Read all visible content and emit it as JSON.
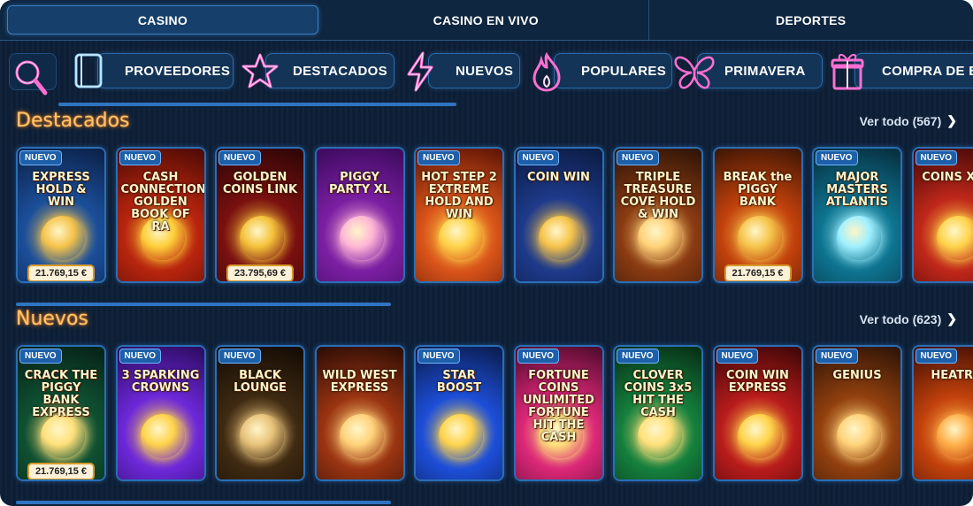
{
  "tabs": [
    "CASINO",
    "CASINO EN VIVO",
    "DEPORTES"
  ],
  "categories": [
    {
      "label": "PROVEEDORES",
      "icon": "book-icon"
    },
    {
      "label": "DESTACADOS",
      "icon": "star-icon"
    },
    {
      "label": "NUEVOS",
      "icon": "lightning-icon"
    },
    {
      "label": "POPULARES",
      "icon": "fire-icon"
    },
    {
      "label": "PRIMAVERA",
      "icon": "butterfly-icon"
    },
    {
      "label": "COMPRA DE BO",
      "icon": "gift-icon"
    }
  ],
  "sections": [
    {
      "title": "Destacados",
      "see_all": "Ver todo (567)",
      "games": [
        {
          "badge": "NUEVO",
          "title": "EXPRESS HOLD & WIN",
          "jackpot": "21.769,15 €"
        },
        {
          "badge": "NUEVO",
          "title": "CASH CONNECTION GOLDEN BOOK OF RA",
          "jackpot": ""
        },
        {
          "badge": "NUEVO",
          "title": "GOLDEN COINS LINK",
          "jackpot": "23.795,69 €"
        },
        {
          "badge": "",
          "title": "PIGGY PARTY XL",
          "jackpot": ""
        },
        {
          "badge": "NUEVO",
          "title": "HOT STEP 2 EXTREME HOLD AND WIN",
          "jackpot": ""
        },
        {
          "badge": "NUEVO",
          "title": "COIN WIN",
          "jackpot": ""
        },
        {
          "badge": "NUEVO",
          "title": "TRIPLE TREASURE COVE HOLD & WIN",
          "jackpot": ""
        },
        {
          "badge": "",
          "title": "BREAK the PIGGY BANK",
          "jackpot": "21.769,15 €"
        },
        {
          "badge": "NUEVO",
          "title": "MAJOR MASTERS ATLANTIS",
          "jackpot": ""
        },
        {
          "badge": "NUEVO",
          "title": "COINS XXL",
          "jackpot": ""
        }
      ]
    },
    {
      "title": "Nuevos",
      "see_all": "Ver todo (623)",
      "games": [
        {
          "badge": "NUEVO",
          "title": "CRACK THE PIGGY BANK EXPRESS",
          "jackpot": "21.769,15 €"
        },
        {
          "badge": "NUEVO",
          "title": "3 SPARKING CROWNS",
          "jackpot": ""
        },
        {
          "badge": "NUEVO",
          "title": "BLACK LOUNGE",
          "jackpot": ""
        },
        {
          "badge": "",
          "title": "WILD WEST EXPRESS",
          "jackpot": ""
        },
        {
          "badge": "NUEVO",
          "title": "STAR BOOST",
          "jackpot": ""
        },
        {
          "badge": "NUEVO",
          "title": "FORTUNE COINS UNLIMITED FORTUNE HIT THE CASH",
          "jackpot": ""
        },
        {
          "badge": "NUEVO",
          "title": "CLOVER COINS 3x5 HIT THE CASH",
          "jackpot": ""
        },
        {
          "badge": "NUEVO",
          "title": "COIN WIN EXPRESS",
          "jackpot": ""
        },
        {
          "badge": "NUEVO",
          "title": "GENIUS",
          "jackpot": ""
        },
        {
          "badge": "NUEVO",
          "title": "HEATRU",
          "jackpot": ""
        }
      ]
    }
  ],
  "colors": {
    "background": "#0d1f36",
    "accent": "#2f74c2",
    "section_title": "#ffc56d",
    "badge": "#1d5fa8",
    "jackpot_bg": "#fbf1d8"
  }
}
